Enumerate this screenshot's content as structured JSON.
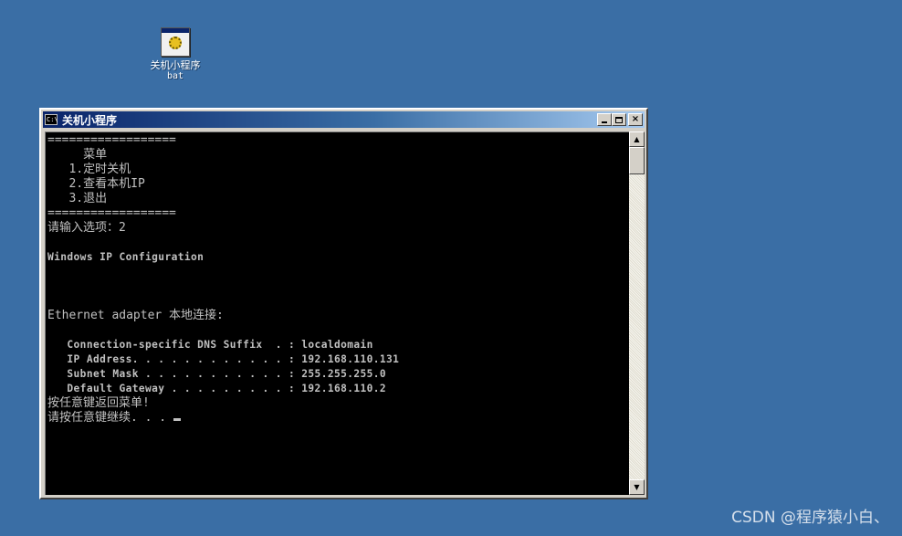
{
  "desktop": {
    "background_color": "#3a6ea5",
    "icon": {
      "name": "关机小程序",
      "ext": "bat",
      "icon_name": "batch-file-gear-icon"
    }
  },
  "window": {
    "title": "关机小程序",
    "icon_name": "console-app-icon",
    "icon_text": "C:\\",
    "buttons": {
      "minimize": "minimize-icon",
      "maximize": "maximize-icon",
      "close": "×"
    }
  },
  "console": {
    "lines": [
      "==================",
      "     菜单",
      "   1.定时关机",
      "   2.查看本机IP",
      "   3.退出",
      "==================",
      "请输入选项：2",
      "",
      "Windows IP Configuration",
      "",
      "",
      "",
      "Ethernet adapter 本地连接:",
      "",
      "   Connection-specific DNS Suffix  . : localdomain",
      "   IP Address. . . . . . . . . . . . : 192.168.110.131",
      "   Subnet Mask . . . . . . . . . . . : 255.255.255.0",
      "   Default Gateway . . . . . . . . . : 192.168.110.2",
      "按任意键返回菜单!",
      "请按任意键继续. . . "
    ]
  },
  "scrollbar": {
    "up": "▲",
    "down": "▼"
  },
  "watermark": "CSDN @程序猿小白、"
}
